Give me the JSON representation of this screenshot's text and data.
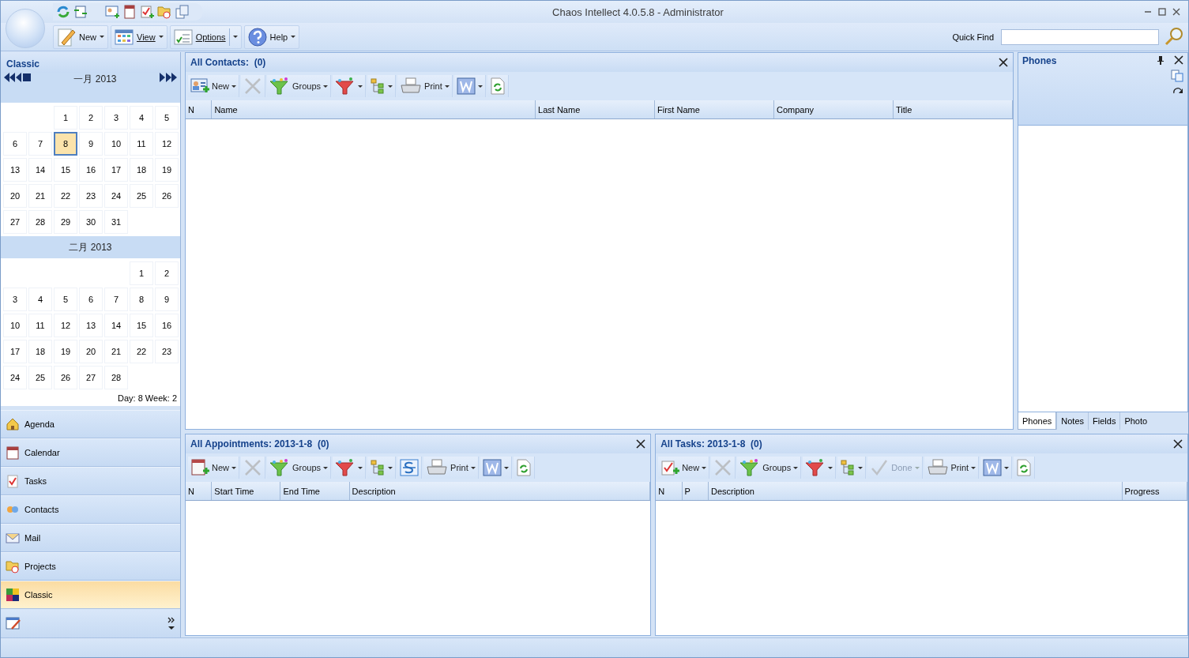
{
  "window": {
    "title": "Chaos Intellect 4.0.5.8  - Administrator"
  },
  "ribbon": {
    "buttons": [
      {
        "kind": "new",
        "label": "New",
        "split": false
      },
      {
        "kind": "view",
        "label": "View",
        "split": false
      },
      {
        "kind": "options",
        "label": "Options",
        "split": true
      },
      {
        "kind": "help",
        "label": "Help",
        "split": false
      }
    ],
    "quick_find": {
      "label": "Quick Find"
    }
  },
  "sidebar": {
    "title": "Classic",
    "months": [
      {
        "title": "一月 2013",
        "nav": true,
        "weeks": [
          [
            {
              "day": "1",
              "selected": false
            },
            {
              "day": "2",
              "selected": false
            },
            {
              "day": "3",
              "selected": false
            },
            {
              "day": "4",
              "selected": false
            },
            {
              "day": "5",
              "selected": false
            }
          ],
          [
            {
              "day": "6",
              "selected": false
            },
            {
              "day": "7",
              "selected": false
            },
            {
              "day": "8",
              "selected": true
            },
            {
              "day": "9",
              "selected": false
            },
            {
              "day": "10",
              "selected": false
            },
            {
              "day": "11",
              "selected": false
            },
            {
              "day": "12",
              "selected": false
            }
          ],
          [
            {
              "day": "13",
              "selected": false
            },
            {
              "day": "14",
              "selected": false
            },
            {
              "day": "15",
              "selected": false
            },
            {
              "day": "16",
              "selected": false
            },
            {
              "day": "17",
              "selected": false
            },
            {
              "day": "18",
              "selected": false
            },
            {
              "day": "19",
              "selected": false
            }
          ],
          [
            {
              "day": "20",
              "selected": false
            },
            {
              "day": "21",
              "selected": false
            },
            {
              "day": "22",
              "selected": false
            },
            {
              "day": "23",
              "selected": false
            },
            {
              "day": "24",
              "selected": false
            },
            {
              "day": "25",
              "selected": false
            },
            {
              "day": "26",
              "selected": false
            }
          ],
          [
            {
              "day": "27",
              "selected": false
            },
            {
              "day": "28",
              "selected": false
            },
            {
              "day": "29",
              "selected": false
            },
            {
              "day": "30",
              "selected": false
            },
            {
              "day": "31",
              "selected": false
            }
          ]
        ]
      },
      {
        "title": "二月 2013",
        "nav": false,
        "weeks": [
          [
            {
              "day": "1",
              "selected": false
            },
            {
              "day": "2",
              "selected": false
            }
          ],
          [
            {
              "day": "3",
              "selected": false
            },
            {
              "day": "4",
              "selected": false
            },
            {
              "day": "5",
              "selected": false
            },
            {
              "day": "6",
              "selected": false
            },
            {
              "day": "7",
              "selected": false
            },
            {
              "day": "8",
              "selected": false
            },
            {
              "day": "9",
              "selected": false
            }
          ],
          [
            {
              "day": "10",
              "selected": false
            },
            {
              "day": "11",
              "selected": false
            },
            {
              "day": "12",
              "selected": false
            },
            {
              "day": "13",
              "selected": false
            },
            {
              "day": "14",
              "selected": false
            },
            {
              "day": "15",
              "selected": false
            },
            {
              "day": "16",
              "selected": false
            }
          ],
          [
            {
              "day": "17",
              "selected": false
            },
            {
              "day": "18",
              "selected": false
            },
            {
              "day": "19",
              "selected": false
            },
            {
              "day": "20",
              "selected": false
            },
            {
              "day": "21",
              "selected": false
            },
            {
              "day": "22",
              "selected": false
            },
            {
              "day": "23",
              "selected": false
            }
          ],
          [
            {
              "day": "24",
              "selected": false
            },
            {
              "day": "25",
              "selected": false
            },
            {
              "day": "26",
              "selected": false
            },
            {
              "day": "27",
              "selected": false
            },
            {
              "day": "28",
              "selected": false
            }
          ]
        ]
      }
    ],
    "day_week": "Day: 8  Week: 2",
    "nav_items": [
      {
        "kind": "agenda",
        "label": "Agenda",
        "selected": false
      },
      {
        "kind": "calendar",
        "label": "Calendar",
        "selected": false
      },
      {
        "kind": "tasks",
        "label": "Tasks",
        "selected": false
      },
      {
        "kind": "contacts",
        "label": "Contacts",
        "selected": false
      },
      {
        "kind": "mail",
        "label": "Mail",
        "selected": false
      },
      {
        "kind": "projects",
        "label": "Projects",
        "selected": false
      },
      {
        "kind": "classic",
        "label": "Classic",
        "selected": true
      }
    ]
  },
  "panels": [
    {
      "title": "All Contacts:  (0)",
      "toolbar": [
        {
          "kind": "new-contact",
          "label": "New",
          "dropdown": true,
          "disabled": false
        },
        {
          "kind": "delete",
          "dropdown": false,
          "disabled": true
        },
        {
          "kind": "groups",
          "label": "Groups",
          "dropdown": true,
          "disabled": false
        },
        {
          "kind": "filter",
          "dropdown": true,
          "disabled": false
        },
        {
          "kind": "tree",
          "dropdown": true,
          "disabled": false
        },
        {
          "kind": "print",
          "label": "Print",
          "dropdown": true,
          "disabled": false
        },
        {
          "kind": "word",
          "dropdown": true,
          "disabled": false
        },
        {
          "kind": "refresh",
          "dropdown": false,
          "disabled": false
        }
      ],
      "columns": [
        "N",
        "Name",
        "Last Name",
        "First Name",
        "Company",
        "Title"
      ]
    },
    {
      "title": "All Appointments: 2013-1-8  (0)",
      "toolbar": [
        {
          "kind": "new-appointment",
          "label": "New",
          "dropdown": true,
          "disabled": false
        },
        {
          "kind": "delete",
          "dropdown": false,
          "disabled": true
        },
        {
          "kind": "groups",
          "label": "Groups",
          "dropdown": true,
          "disabled": false
        },
        {
          "kind": "filter",
          "dropdown": true,
          "disabled": false
        },
        {
          "kind": "tree",
          "dropdown": true,
          "disabled": false
        },
        {
          "kind": "strike",
          "dropdown": false,
          "disabled": false
        },
        {
          "kind": "print",
          "label": "Print",
          "dropdown": true,
          "disabled": false
        },
        {
          "kind": "word",
          "dropdown": true,
          "disabled": false
        },
        {
          "kind": "refresh",
          "dropdown": false,
          "disabled": false
        }
      ],
      "columns": [
        "N",
        "Start Time",
        "End Time",
        "Description"
      ]
    },
    {
      "title": "All Tasks: 2013-1-8  (0)",
      "toolbar": [
        {
          "kind": "new-task",
          "label": "New",
          "dropdown": true,
          "disabled": false
        },
        {
          "kind": "delete",
          "dropdown": false,
          "disabled": true
        },
        {
          "kind": "groups",
          "label": "Groups",
          "dropdown": true,
          "disabled": false
        },
        {
          "kind": "filter",
          "dropdown": true,
          "disabled": false
        },
        {
          "kind": "tree",
          "dropdown": true,
          "disabled": false
        },
        {
          "kind": "done",
          "label": "Done",
          "dropdown": true,
          "disabled": true
        },
        {
          "kind": "print",
          "label": "Print",
          "dropdown": true,
          "disabled": false
        },
        {
          "kind": "word",
          "dropdown": true,
          "disabled": false
        },
        {
          "kind": "refresh",
          "dropdown": false,
          "disabled": false
        }
      ],
      "columns": [
        "N",
        "P",
        "Description",
        "Progress"
      ]
    }
  ],
  "side_panel": {
    "title": "Phones",
    "tabs": [
      {
        "label": "Phones",
        "selected": true
      },
      {
        "label": "Notes",
        "selected": false
      },
      {
        "label": "Fields",
        "selected": false
      },
      {
        "label": "Photo",
        "selected": false
      }
    ]
  }
}
